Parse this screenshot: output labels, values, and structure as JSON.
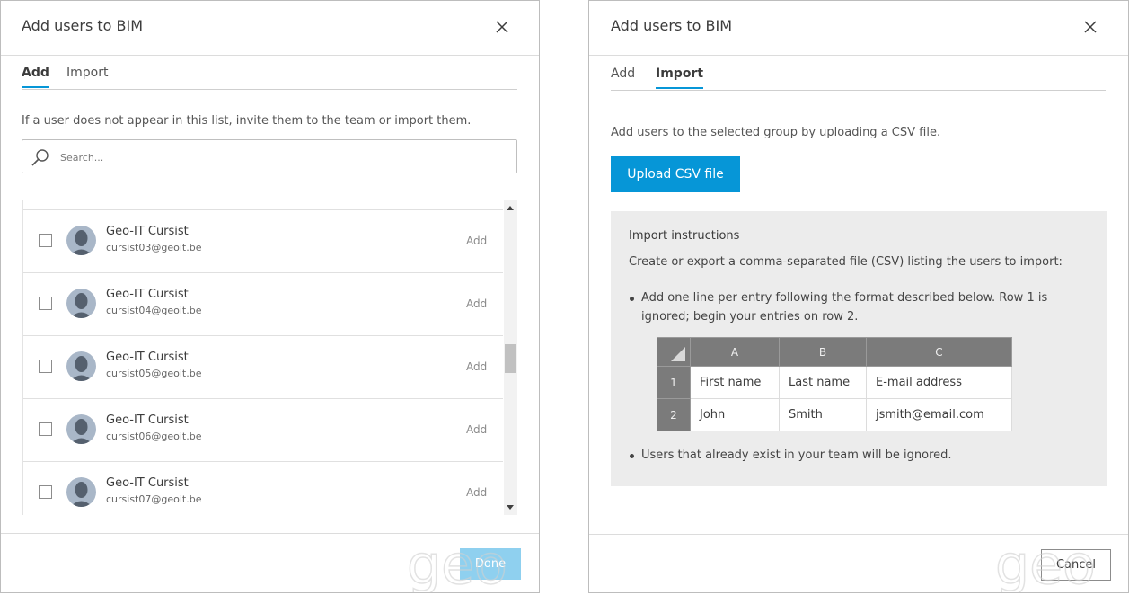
{
  "left": {
    "title": "Add users to BIM",
    "tabs": [
      "Add",
      "Import"
    ],
    "hint": "If a user does not appear in this list, invite them to the team or import them.",
    "search_placeholder": "Search...",
    "users": [
      {
        "name": "Geo-IT Cursist",
        "email": "cursist03@geoit.be",
        "action": "Add"
      },
      {
        "name": "Geo-IT Cursist",
        "email": "cursist04@geoit.be",
        "action": "Add"
      },
      {
        "name": "Geo-IT Cursist",
        "email": "cursist05@geoit.be",
        "action": "Add"
      },
      {
        "name": "Geo-IT Cursist",
        "email": "cursist06@geoit.be",
        "action": "Add"
      },
      {
        "name": "Geo-IT Cursist",
        "email": "cursist07@geoit.be",
        "action": "Add"
      }
    ],
    "done_label": "Done"
  },
  "right": {
    "title": "Add users to BIM",
    "tabs": [
      "Add",
      "Import"
    ],
    "description": "Add users to the selected group by uploading a CSV file.",
    "upload_label": "Upload CSV file",
    "instructions": {
      "title": "Import instructions",
      "intro": "Create or export a comma-separated file (CSV) listing the users to import:",
      "bullet1": "Add one line per entry following the format described below. Row 1 is ignored; begin your entries on row 2.",
      "bullet2": "Users that already exist in your team will be ignored.",
      "table": {
        "columns": [
          "A",
          "B",
          "C"
        ],
        "rows": [
          {
            "num": "1",
            "cells": [
              "First name",
              "Last name",
              "E-mail address"
            ]
          },
          {
            "num": "2",
            "cells": [
              "John",
              "Smith",
              "jsmith@email.com"
            ]
          }
        ]
      }
    },
    "cancel_label": "Cancel"
  },
  "watermark": "geo",
  "colors": {
    "accent": "#0696d7",
    "done_disabled": "#8fd0ef",
    "instructions_bg": "#ececec",
    "table_header": "#7b7b7b"
  }
}
